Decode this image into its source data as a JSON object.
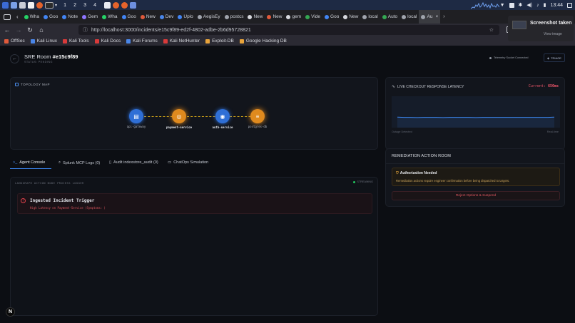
{
  "taskbar": {
    "workspaces": [
      "1",
      "2",
      "3",
      "4"
    ],
    "clock": "13:44"
  },
  "tabs": [
    {
      "label": "Wha",
      "active": false
    },
    {
      "label": "Goo",
      "active": false
    },
    {
      "label": "Note",
      "active": false
    },
    {
      "label": "Gem",
      "active": false
    },
    {
      "label": "Wha",
      "active": false
    },
    {
      "label": "Goo",
      "active": false
    },
    {
      "label": "New",
      "active": false
    },
    {
      "label": "Dev",
      "active": false
    },
    {
      "label": "Uplo",
      "active": false
    },
    {
      "label": "AegisEy",
      "active": false
    },
    {
      "label": "postcs",
      "active": false
    },
    {
      "label": "New",
      "active": false
    },
    {
      "label": "New",
      "active": false
    },
    {
      "label": "gem",
      "active": false
    },
    {
      "label": "Vide",
      "active": false
    },
    {
      "label": "Goo",
      "active": false
    },
    {
      "label": "New",
      "active": false
    },
    {
      "label": "local",
      "active": false
    },
    {
      "label": "Auto",
      "active": false
    },
    {
      "label": "local",
      "active": false
    },
    {
      "label": "Au",
      "active": true
    }
  ],
  "url": "http://localhost:3000/incidents/e15c9f89-ed2f-4802-adbe-2b6d95728821",
  "bookmarks": [
    "OffSec",
    "Kali Linux",
    "Kali Tools",
    "Kali Docs",
    "Kali Forums",
    "Kali NetHunter",
    "Exploit-DB",
    "Google Hacking DB"
  ],
  "notification": {
    "title": "Screenshot taken",
    "action": "View image"
  },
  "header": {
    "room_prefix": "SRE Room",
    "room_id": "#e15c9f89",
    "status_label": "STATUS:",
    "status_value": "PENDING",
    "telemetry": "Telemetry Socket Connected",
    "triage": "TRIAGE"
  },
  "topology": {
    "title": "TOPOLOGY MAP",
    "nodes": [
      {
        "label": "api-gateway",
        "color": "#2f6fd6"
      },
      {
        "label": "payment-service",
        "color": "#e08a1e"
      },
      {
        "label": "auth-service",
        "color": "#2f6fd6"
      },
      {
        "label": "postgres-db",
        "color": "#e08a1e"
      }
    ]
  },
  "latency": {
    "title": "LIVE CHECKOUT RESPONSE LATENCY",
    "current_label": "Current:",
    "current_value": "650ms",
    "left_caption": "Outage Detected",
    "right_caption": "Real-time",
    "series": [
      48,
      47,
      47,
      46,
      47,
      47,
      47,
      46,
      47,
      47,
      47,
      47,
      46,
      47,
      47,
      47,
      47,
      47,
      47,
      47,
      47,
      47,
      47,
      47,
      48
    ]
  },
  "console_tabs": [
    {
      "label": "Agent Console",
      "active": true,
      "icon": "terminal-icon"
    },
    {
      "label": "Splunk MCP Logs (0)",
      "active": false,
      "icon": "search-icon"
    },
    {
      "label": "Audit indexstore_audit (0)",
      "active": false,
      "icon": "document-icon"
    },
    {
      "label": "ChatOps Simulation",
      "active": false,
      "icon": "chat-icon"
    }
  ],
  "console": {
    "logger_title": "LANGGRAPH ACTION NODE PROCESS LOGGER",
    "streaming": "STREAMING",
    "event_title": "Ingested Incident Trigger",
    "event_detail": "High Latency on Payment-Service (Symptoms: )"
  },
  "remediation": {
    "title": "REMEDIATION ACTION ROOM",
    "auth_title": "Authorization Needed",
    "auth_detail": "Remediation actions require engineer confirmation before being dispatched to targets.",
    "reject_button": "Reject Options & Suspend"
  },
  "colors": {
    "accent_blue": "#2f6fd6",
    "accent_orange": "#e08a1e",
    "danger": "#e0414b",
    "current_value": "#f0566a"
  }
}
